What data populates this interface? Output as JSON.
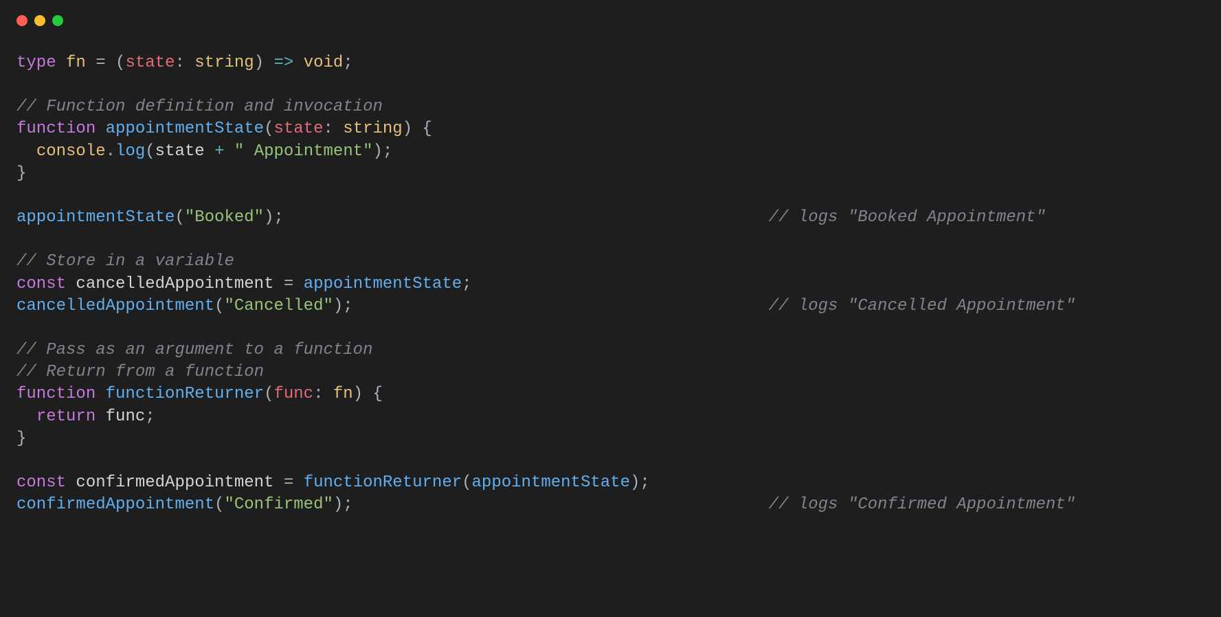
{
  "code": {
    "line1": {
      "kw_type": "type",
      "typename": "fn",
      "eq": " = ",
      "lparen": "(",
      "param": "state",
      "colon": ": ",
      "ptype": "string",
      "rparen": ")",
      "arrow": " => ",
      "rettype": "void",
      "semi": ";"
    },
    "line3_comment": "// Function definition and invocation",
    "line4": {
      "kw_function": "function",
      "name": "appointmentState",
      "lparen": "(",
      "param": "state",
      "colon": ": ",
      "ptype": "string",
      "rparen_brace": ") {"
    },
    "line5": {
      "indent": "  ",
      "console": "console",
      "dot": ".",
      "log": "log",
      "lparen": "(",
      "ident": "state",
      "plus": " + ",
      "str": "\" Appointment\"",
      "rparen_semi": ");"
    },
    "line6_close": "}",
    "line8": {
      "call": "appointmentState",
      "lparen": "(",
      "str": "\"Booked\"",
      "rparen_semi": ");",
      "comment": "// logs \"Booked Appointment\""
    },
    "line10_comment": "// Store in a variable",
    "line11": {
      "kw_const": "const",
      "name": "cancelledAppointment",
      "eq": " = ",
      "rhs": "appointmentState",
      "semi": ";"
    },
    "line12": {
      "call": "cancelledAppointment",
      "lparen": "(",
      "str": "\"Cancelled\"",
      "rparen_semi": ");",
      "comment": "// logs \"Cancelled Appointment\""
    },
    "line14_comment": "// Pass as an argument to a function",
    "line15_comment": "// Return from a function",
    "line16": {
      "kw_function": "function",
      "name": "functionReturner",
      "lparen": "(",
      "param": "func",
      "colon": ": ",
      "ptype": "fn",
      "rparen_brace": ") {"
    },
    "line17": {
      "indent": "  ",
      "kw_return": "return",
      "sp": " ",
      "ident": "func",
      "semi": ";"
    },
    "line18_close": "}",
    "line20": {
      "kw_const": "const",
      "name": "confirmedAppointment",
      "eq": " = ",
      "call": "functionReturner",
      "lparen": "(",
      "arg": "appointmentState",
      "rparen_semi": ");"
    },
    "line21": {
      "call": "confirmedAppointment",
      "lparen": "(",
      "str": "\"Confirmed\"",
      "rparen_semi": ");",
      "comment": "// logs \"Confirmed Appointment\""
    }
  },
  "comment_column": 76
}
